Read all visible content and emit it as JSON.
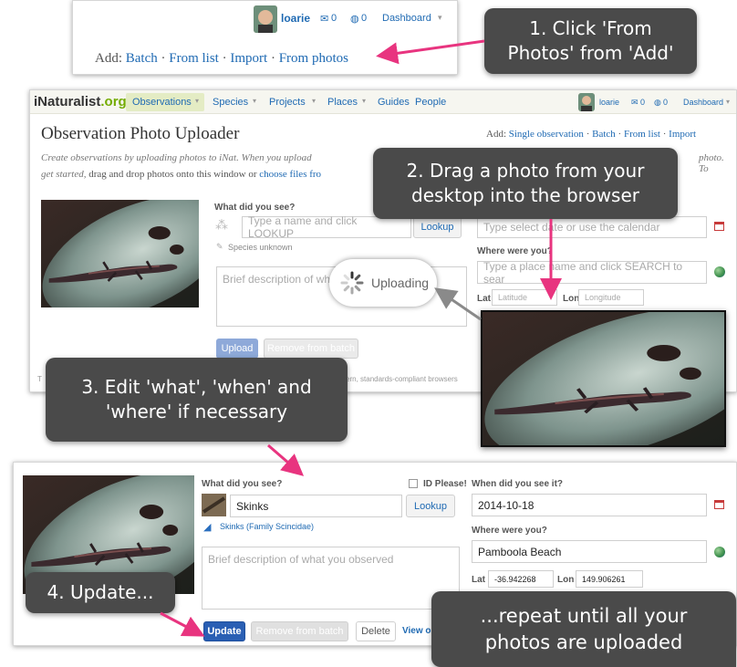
{
  "user": {
    "name": "loarie",
    "messages": "0",
    "updates": "0",
    "dashboard": "Dashboard"
  },
  "top_panel": {
    "add_label": "Add:",
    "links": [
      "Batch",
      "From list",
      "Import",
      "From photos"
    ]
  },
  "main_panel": {
    "logo": {
      "brand": "iNaturalist",
      "tld": ".org"
    },
    "nav": [
      "Observations",
      "Species",
      "Projects",
      "Places",
      "Guides",
      "People"
    ],
    "title": "Observation Photo Uploader",
    "add_label": "Add:",
    "add_links": [
      "Single observation",
      "Batch",
      "From list",
      "Import"
    ],
    "intro_1": "Create observations by uploading photos to iNat. When you upload",
    "intro_1b": "photo. To",
    "intro_2a": "get started,",
    "intro_2b": "drag and drop photos onto this window or",
    "intro_2c": "choose files fro",
    "what_label": "What did you see?",
    "what_placeholder": "Type a name and click LOOKUP",
    "lookup": "Lookup",
    "species_unknown": "Species unknown",
    "desc_placeholder": "Brief description of wh",
    "when_placeholder": "Type select date or use the calendar",
    "where_label": "Where were you?",
    "where_placeholder": "Type a place name and click SEARCH to sear",
    "lat_label": "Lat",
    "lat_placeholder": "Latitude",
    "lon_label": "Lon",
    "lon_placeholder": "Longitude",
    "uploading": "Uploading",
    "upload_btn": "Upload",
    "remove_btn": "Remove from batch",
    "footer_a": "T",
    "footer_b": "in modern, standards-compliant browsers"
  },
  "bottom_panel": {
    "what_label": "What did you see?",
    "id_please": "ID Please!",
    "what_value": "Skinks",
    "lookup": "Lookup",
    "taxon": "Skinks (Family Scincidae)",
    "desc_placeholder": "Brief description of what you observed",
    "when_label": "When did you see it?",
    "when_value": "2014-10-18",
    "where_label": "Where were you?",
    "where_value": "Pamboola Beach",
    "lat_label": "Lat",
    "lat_value": "-36.942268",
    "lon_label": "Lon",
    "lon_value": "149.906261",
    "update_btn": "Update",
    "remove_btn": "Remove from batch",
    "delete_btn": "Delete",
    "view_link": "View obs"
  },
  "callouts": {
    "c1": [
      "1. Click 'From",
      "Photos' from 'Add'"
    ],
    "c2": [
      "2. Drag a photo from your",
      "desktop into the browser"
    ],
    "c3": [
      "3. Edit 'what', 'when' and",
      "'where' if necessary"
    ],
    "c4": [
      "4. Update..."
    ],
    "c5": [
      "...repeat until all your",
      "photos are uploaded"
    ]
  },
  "colors": {
    "arrow_pink": "#e8347f",
    "arrow_gray": "#8a8a8a",
    "callout_bg": "#4a4a4a",
    "link_blue": "#1f6ab3",
    "nav_bar": "#f6f6f0"
  }
}
